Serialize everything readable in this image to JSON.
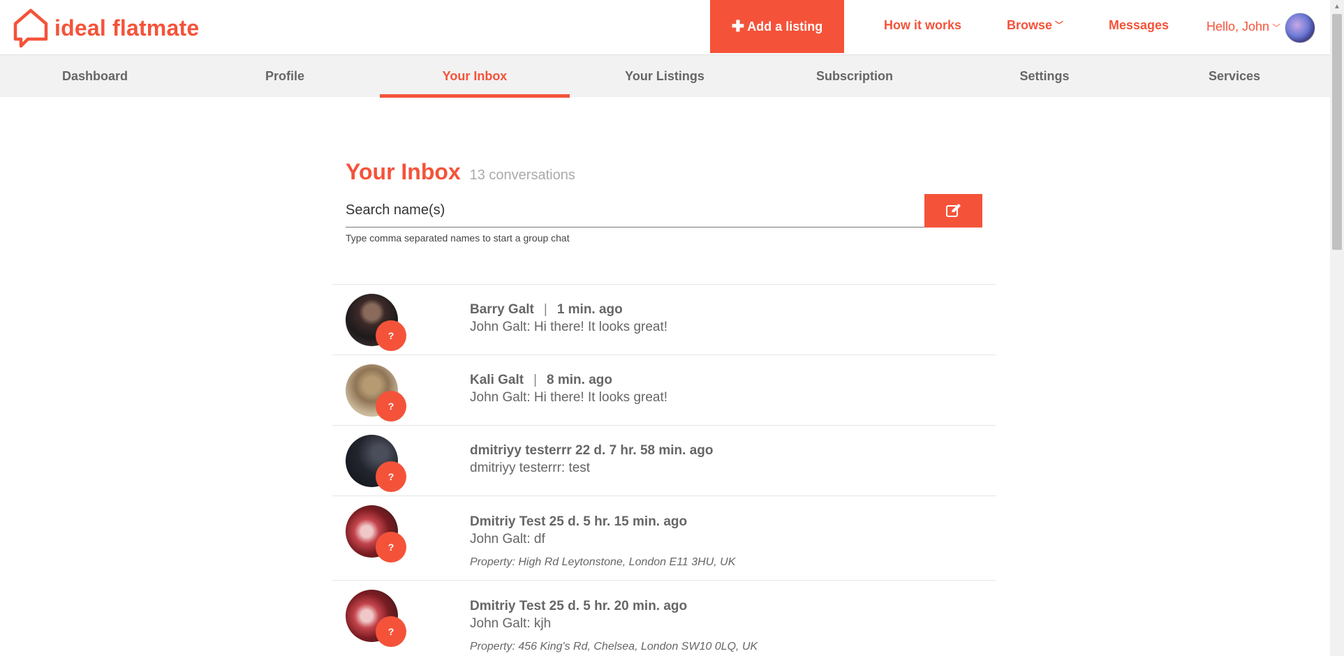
{
  "header": {
    "logo_text": "ideal flatmate",
    "add_listing_label": "Add a listing",
    "nav": [
      {
        "label": "How it works"
      },
      {
        "label": "Browse"
      },
      {
        "label": "Messages"
      }
    ],
    "greeting": "Hello, John"
  },
  "subnav": {
    "tabs": [
      {
        "label": "Dashboard"
      },
      {
        "label": "Profile"
      },
      {
        "label": "Your Inbox"
      },
      {
        "label": "Your Listings"
      },
      {
        "label": "Subscription"
      },
      {
        "label": "Settings"
      },
      {
        "label": "Services"
      }
    ],
    "active_tab": "Your Inbox"
  },
  "inbox": {
    "title": "Your Inbox",
    "count_label": "13 conversations",
    "search_placeholder": "Search name(s)",
    "hint": "Type comma separated names to start a group chat"
  },
  "conversations": [
    {
      "name": "Barry Galt",
      "separator": "|",
      "time": "1 min. ago",
      "message": "John Galt: Hi there! It looks great!",
      "badge": "?",
      "property": ""
    },
    {
      "name": "Kali Galt",
      "separator": "|",
      "time": "8 min. ago",
      "message": "John Galt: Hi there! It looks great!",
      "badge": "?",
      "property": ""
    },
    {
      "name": "dmitriyy testerrr 22 d. 7 hr. 58 min. ago",
      "separator": "",
      "time": "",
      "message": "dmitriyy testerrr: test",
      "badge": "?",
      "property": ""
    },
    {
      "name": "Dmitriy Test 25 d. 5 hr. 15 min. ago",
      "separator": "",
      "time": "",
      "message": "John Galt: df",
      "badge": "?",
      "property": "Property: High Rd Leytonstone, London E11 3HU, UK"
    },
    {
      "name": "Dmitriy Test 25 d. 5 hr. 20 min. ago",
      "separator": "",
      "time": "",
      "message": "John Galt: kjh",
      "badge": "?",
      "property": "Property: 456 King's Rd, Chelsea, London SW10 0LQ, UK"
    }
  ],
  "colors": {
    "brand": "#f4533a",
    "text": "#666666",
    "subnav_bg": "#f2f2f2"
  },
  "icons": {
    "logo": "house-chat-icon",
    "add": "plus-icon",
    "browse": "chevron-down-icon",
    "compose": "edit-icon"
  }
}
